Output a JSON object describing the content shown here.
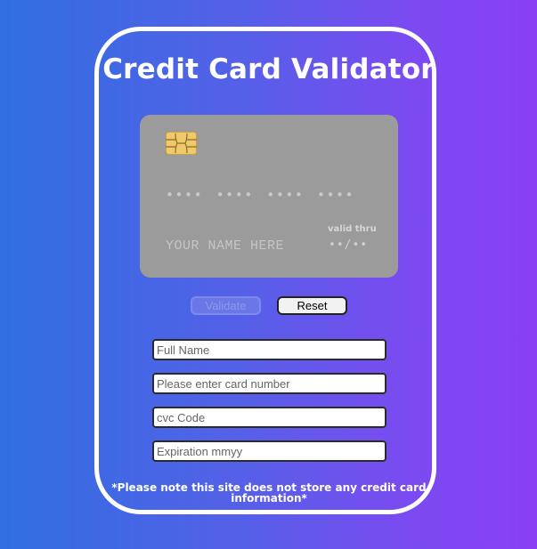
{
  "app": {
    "title": "Credit Card Validator"
  },
  "card": {
    "number_mask": "•••• •••• •••• ••••",
    "name_placeholder": "YOUR NAME HERE",
    "valid_label": "valid thru",
    "valid_mask": "••/••",
    "chip_icon": "card-chip-icon"
  },
  "buttons": {
    "validate_label": "Validate",
    "reset_label": "Reset"
  },
  "form": {
    "full_name": {
      "placeholder": "Full Name",
      "value": ""
    },
    "card_number": {
      "placeholder": "Please enter card number",
      "value": ""
    },
    "cvc": {
      "placeholder": "cvc Code",
      "value": ""
    },
    "expiration": {
      "placeholder": "Expiration mmyy",
      "value": ""
    }
  },
  "notice": {
    "text": "*Please note this site does not store any credit card information*"
  },
  "colors": {
    "gradient_start": "#2f6fe0",
    "gradient_end": "#8a3ff5",
    "card_bg": "#9b9b9b",
    "chip": "#f0c96a"
  }
}
